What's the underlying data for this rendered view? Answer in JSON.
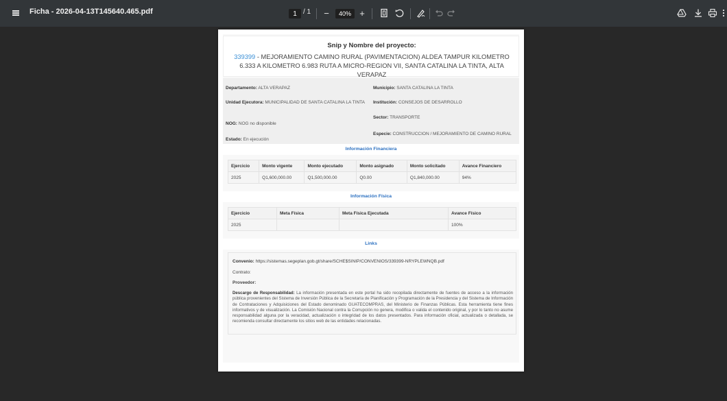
{
  "toolbar": {
    "title": "Ficha - 2026-04-13T145640.465.pdf",
    "page_current": "1",
    "page_total": "/ 1",
    "zoom": "40%",
    "zoom_out": "−",
    "zoom_in": "+"
  },
  "project": {
    "heading": "Snip y Nombre del proyecto:",
    "code": "339399",
    "name": " - MEJORAMIENTO CAMINO RURAL (PAVIMENTACION) ALDEA TAMPUR KILOMETRO 6.333 A KILOMETRO 6.983 RUTA A MICRO-REGION VII, SANTA CATALINA LA TINTA, ALTA VERAPAZ",
    "departamento_label": "Departamento:",
    "departamento": " ALTA VERAPAZ",
    "unidad_label": "Unidad Ejecutora:",
    "unidad": " MUNICIPALIDAD DE SANTA CATALINA LA TINTA",
    "nog_label": "NOG:",
    "nog": " NOG no disponible",
    "estado_label": "Estado:",
    "estado": " En ejecución",
    "municipio_label": "Municipio:",
    "municipio": " SANTA CATALINA LA TINTA",
    "institucion_label": "Institución:",
    "institucion": " CONSEJOS DE DESARROLLO",
    "sector_label": "Sector:",
    "sector": " TRANSPORTE",
    "especie_label": "Especie:",
    "especie": " CONSTRUCCION / MEJORAMIENTO DE CAMINO RURAL"
  },
  "financiera": {
    "title": "Información Financiera",
    "headers": [
      "Ejercicio",
      "Monto vigente",
      "Monto ejecutado",
      "Monto asignado",
      "Monto solicitado",
      "Avance Financiero"
    ],
    "row": [
      "2025",
      "Q1,600,000.00",
      "Q1,500,000.00",
      "Q0.00",
      "Q1,840,000.00",
      "94%"
    ]
  },
  "fisica": {
    "title": "Información Física",
    "headers": [
      "Ejercicio",
      "Meta Física",
      "Meta Física Ejecutada",
      "Avance Físico"
    ],
    "row": [
      "2025",
      "",
      "",
      "100%"
    ]
  },
  "links": {
    "title": "Links",
    "convenio_label": "Convenio:",
    "convenio": " https://sistemas.segeplan.gob.gt/share/SCHE$SINIP/CONVENIOS/339399-NRYPLEWNQB.pdf",
    "contrato_label": "Contrato:",
    "proveedor_label": "Proveedor:",
    "descargo_label": "Descargo de Responsabilidad:",
    "descargo": " La información presentada en este portal ha sido recopilada directamente de fuentes de acceso a la información pública provenientes del Sistema de Inversión Pública de la Secretaría de Planificación y Programación de la Presidencia y del Sistema de Información de Contrataciones y Adquisiciones del Estado denominado GUATECOMPRAS, del Ministerio de Finanzas Públicas. Esta herramienta tiene fines informativos y de visualización. La Comisión Nacional contra la Corrupción no genera, modifica o valida el contenido original, y por lo tanto no asume responsabilidad alguna por la veracidad, actualización o integridad de los datos presentados. Para información oficial, actualizada o detallada, se recomienda consultar directamente los sitios web de las entidades relacionadas."
  }
}
